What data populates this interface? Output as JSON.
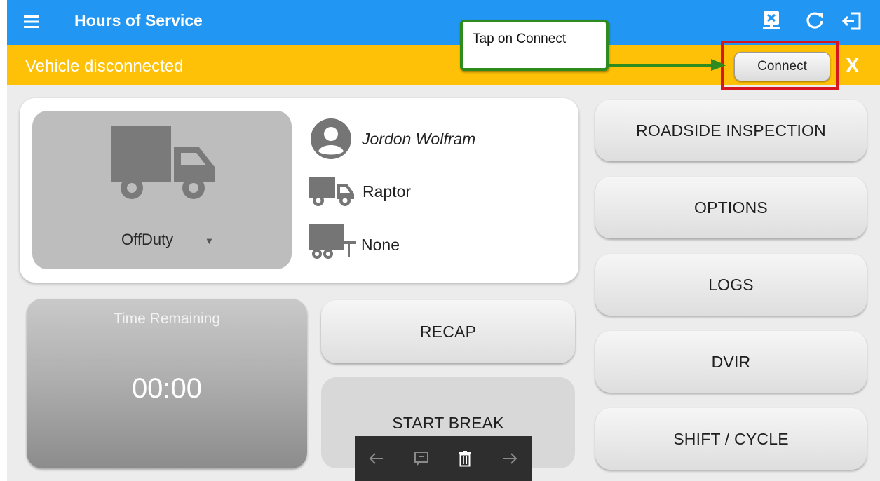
{
  "appbar": {
    "title": "Hours of Service",
    "icons": [
      "menu-icon",
      "disconnect-icon",
      "refresh-icon",
      "logout-icon"
    ]
  },
  "banner": {
    "text": "Vehicle disconnected",
    "connect_label": "Connect",
    "close_label": "X"
  },
  "callout": {
    "text": "Tap on Connect"
  },
  "driver": {
    "duty_status": "OffDuty",
    "name": "Jordon Wolfram",
    "vehicle": "Raptor",
    "trailer": "None"
  },
  "time_remaining": {
    "label": "Time Remaining",
    "value": "00:00"
  },
  "buttons": {
    "recap": "RECAP",
    "start_break": "START BREAK",
    "roadside": "ROADSIDE INSPECTION",
    "options": "OPTIONS",
    "logs": "LOGS",
    "dvir": "DVIR",
    "shift_cycle": "SHIFT / CYCLE"
  },
  "toolbar": {
    "icons": [
      "arrow-left-icon",
      "comment-icon",
      "trash-icon",
      "arrow-right-icon"
    ]
  },
  "colors": {
    "appbar": "#2196f3",
    "banner": "#ffc107",
    "highlight_box": "#d6171f",
    "callout_border": "#2e8b1d"
  }
}
